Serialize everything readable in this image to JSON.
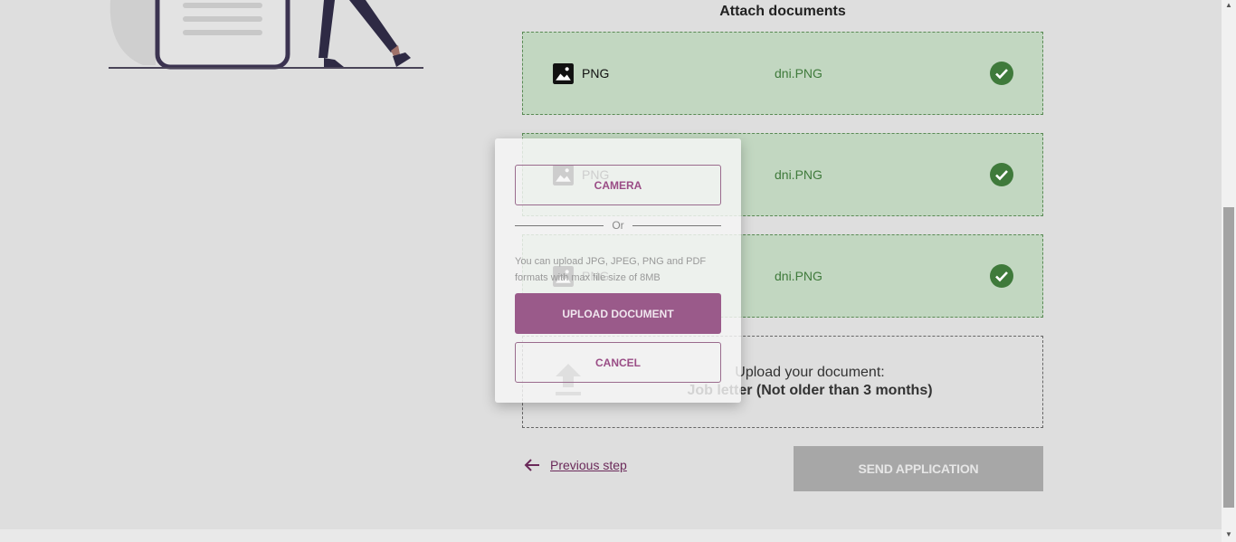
{
  "section_title": "Attach documents",
  "documents": [
    {
      "type": "PNG",
      "filename": "dni.PNG",
      "icon": "image-icon",
      "status": "check-icon"
    },
    {
      "type": "PNG",
      "filename": "dni.PNG",
      "icon": "image-icon",
      "status": "check-icon"
    },
    {
      "type": "PNG",
      "filename": "dni.PNG",
      "icon": "image-icon",
      "status": "check-icon"
    }
  ],
  "upload_box": {
    "line1": "Upload your document:",
    "line2": "Job letter (Not older than 3 months)",
    "icon": "upload-icon"
  },
  "nav": {
    "previous_label": "Previous step",
    "send_label": "SEND APPLICATION"
  },
  "modal": {
    "camera_label": "CAMERA",
    "or_label": "Or",
    "hint": "You can upload JPG, JPEG, PNG and PDF formats with max file size of 8MB",
    "upload_label": "UPLOAD DOCUMENT",
    "cancel_label": "CANCEL"
  },
  "colors": {
    "success_bg": "#c2d7c1",
    "success_text": "#3f7a3b",
    "accent": "#9a5a8a",
    "link": "#6b2a5a",
    "disabled": "#a7a7a7"
  }
}
